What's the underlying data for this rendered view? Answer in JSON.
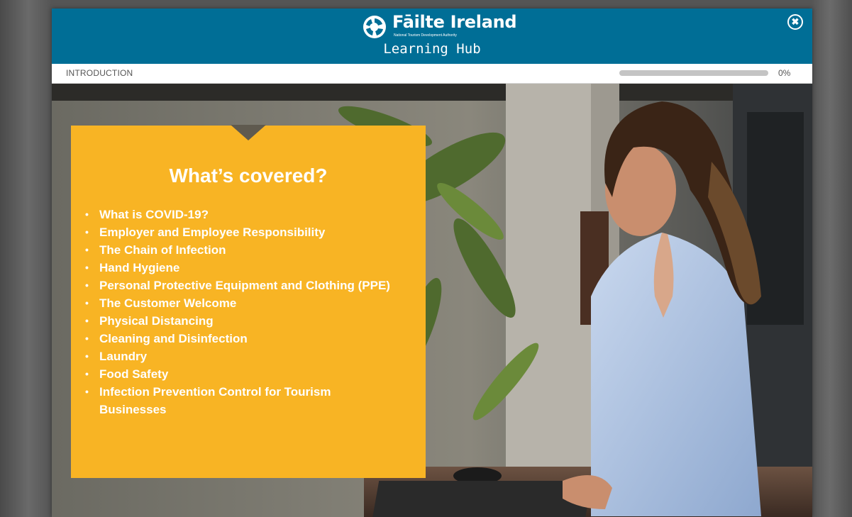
{
  "header": {
    "brand_name": "Fāilte Ireland",
    "brand_tagline": "National Tourism Development Authority",
    "hub_title": "Learning Hub",
    "close_symbol": "✖",
    "background_color": "#006e96"
  },
  "progress": {
    "section_label": "INTRODUCTION",
    "percent_label": "0%",
    "value": 0
  },
  "card": {
    "background_color": "#f8b424",
    "title": "What’s covered?",
    "bullet": "•",
    "topics": [
      "What is COVID-19?",
      "Employer and Employee Responsibility",
      "The Chain of Infection",
      "Hand Hygiene",
      "Personal Protective Equipment and Clothing (PPE)",
      "The Customer Welcome",
      "Physical Distancing",
      "Cleaning and Disinfection",
      "Laundry",
      "Food Safety",
      "Infection Prevention Control for Tourism Businesses"
    ]
  },
  "icons": {
    "logo": "failte-ireland-logo-icon",
    "close": "close-icon"
  }
}
